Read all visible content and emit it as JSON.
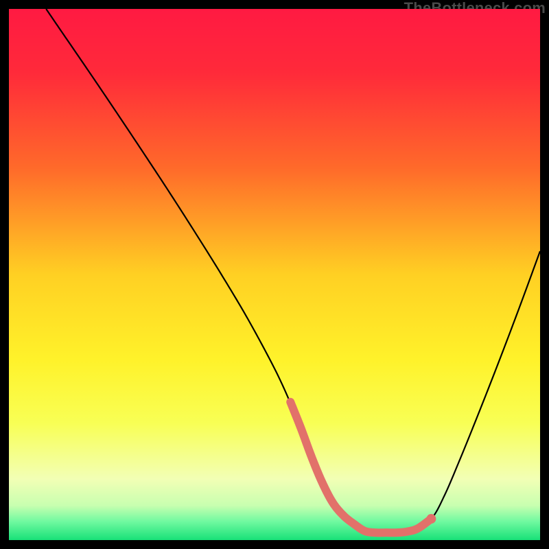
{
  "watermark": "TheBottleneck.com",
  "chart_data": {
    "type": "line",
    "title": "",
    "xlabel": "",
    "ylabel": "",
    "xlim": [
      0,
      100
    ],
    "ylim": [
      0,
      100
    ],
    "gradient_stops": [
      {
        "offset": 0,
        "color": "#ff1a42"
      },
      {
        "offset": 0.12,
        "color": "#ff2a3a"
      },
      {
        "offset": 0.3,
        "color": "#ff6a2a"
      },
      {
        "offset": 0.5,
        "color": "#ffd023"
      },
      {
        "offset": 0.66,
        "color": "#fff22a"
      },
      {
        "offset": 0.78,
        "color": "#f8ff55"
      },
      {
        "offset": 0.885,
        "color": "#f2ffb5"
      },
      {
        "offset": 0.935,
        "color": "#c8ffb0"
      },
      {
        "offset": 0.965,
        "color": "#70f9a0"
      },
      {
        "offset": 1.0,
        "color": "#18e178"
      }
    ],
    "series": [
      {
        "name": "bottleneck-curve",
        "type": "line",
        "x": [
          7,
          10,
          15,
          20,
          25,
          30,
          35,
          40,
          45,
          50,
          53,
          55,
          58,
          61,
          64,
          67,
          70,
          73,
          76,
          79.5,
          82,
          85,
          88,
          91,
          94,
          97,
          100
        ],
        "y": [
          100,
          95.6,
          88.3,
          80.9,
          73.4,
          65.8,
          58.0,
          50.0,
          41.6,
          32.3,
          25.8,
          20.8,
          13.0,
          7.0,
          3.4,
          1.7,
          1.4,
          1.4,
          1.8,
          4.0,
          8.4,
          15.4,
          22.8,
          30.4,
          38.2,
          46.2,
          54.4
        ]
      },
      {
        "name": "flat-highlight",
        "type": "line",
        "x": [
          53,
          55,
          57,
          59,
          61,
          63,
          65,
          67,
          69,
          71,
          73,
          75,
          77,
          79.5
        ],
        "y": [
          26,
          21,
          15.6,
          10.8,
          7.0,
          4.6,
          3.0,
          1.7,
          1.4,
          1.4,
          1.4,
          1.6,
          2.2,
          4.0
        ]
      }
    ],
    "markers": [
      {
        "name": "end-dot",
        "x": 79.5,
        "y": 4.0
      }
    ],
    "colors": {
      "curve": "#000000",
      "highlight": "#e2716a",
      "marker": "#e2716a"
    }
  }
}
